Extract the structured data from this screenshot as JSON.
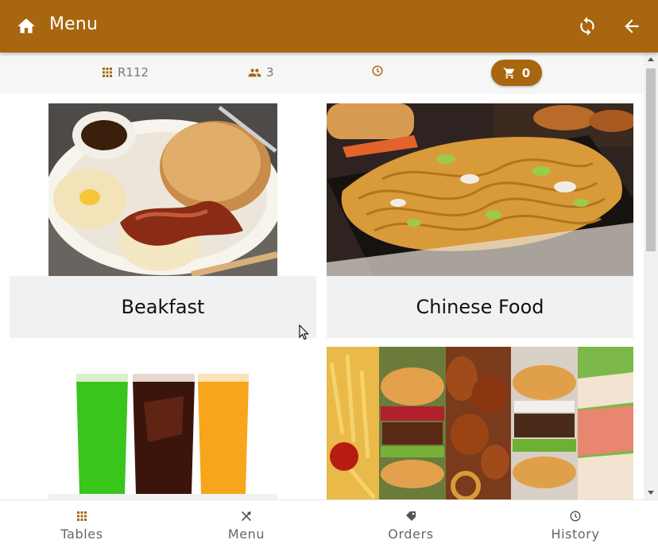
{
  "appbar": {
    "title": "Menu",
    "background": "#a7660f"
  },
  "info": {
    "table": "R112",
    "guests": "3",
    "cart_count": "0",
    "accent": "#a7660f"
  },
  "categories": [
    {
      "label": "Beakfast"
    },
    {
      "label": "Chinese Food"
    },
    {
      "label": ""
    },
    {
      "label": ""
    }
  ],
  "nav": {
    "tables": "Tables",
    "menu": "Menu",
    "orders": "Orders",
    "history": "History"
  },
  "icons": [
    "home-icon",
    "sync-icon",
    "back-arrow-icon",
    "grid-icon",
    "people-icon",
    "clock-icon",
    "cart-icon",
    "utensils-icon",
    "tag-icon"
  ]
}
